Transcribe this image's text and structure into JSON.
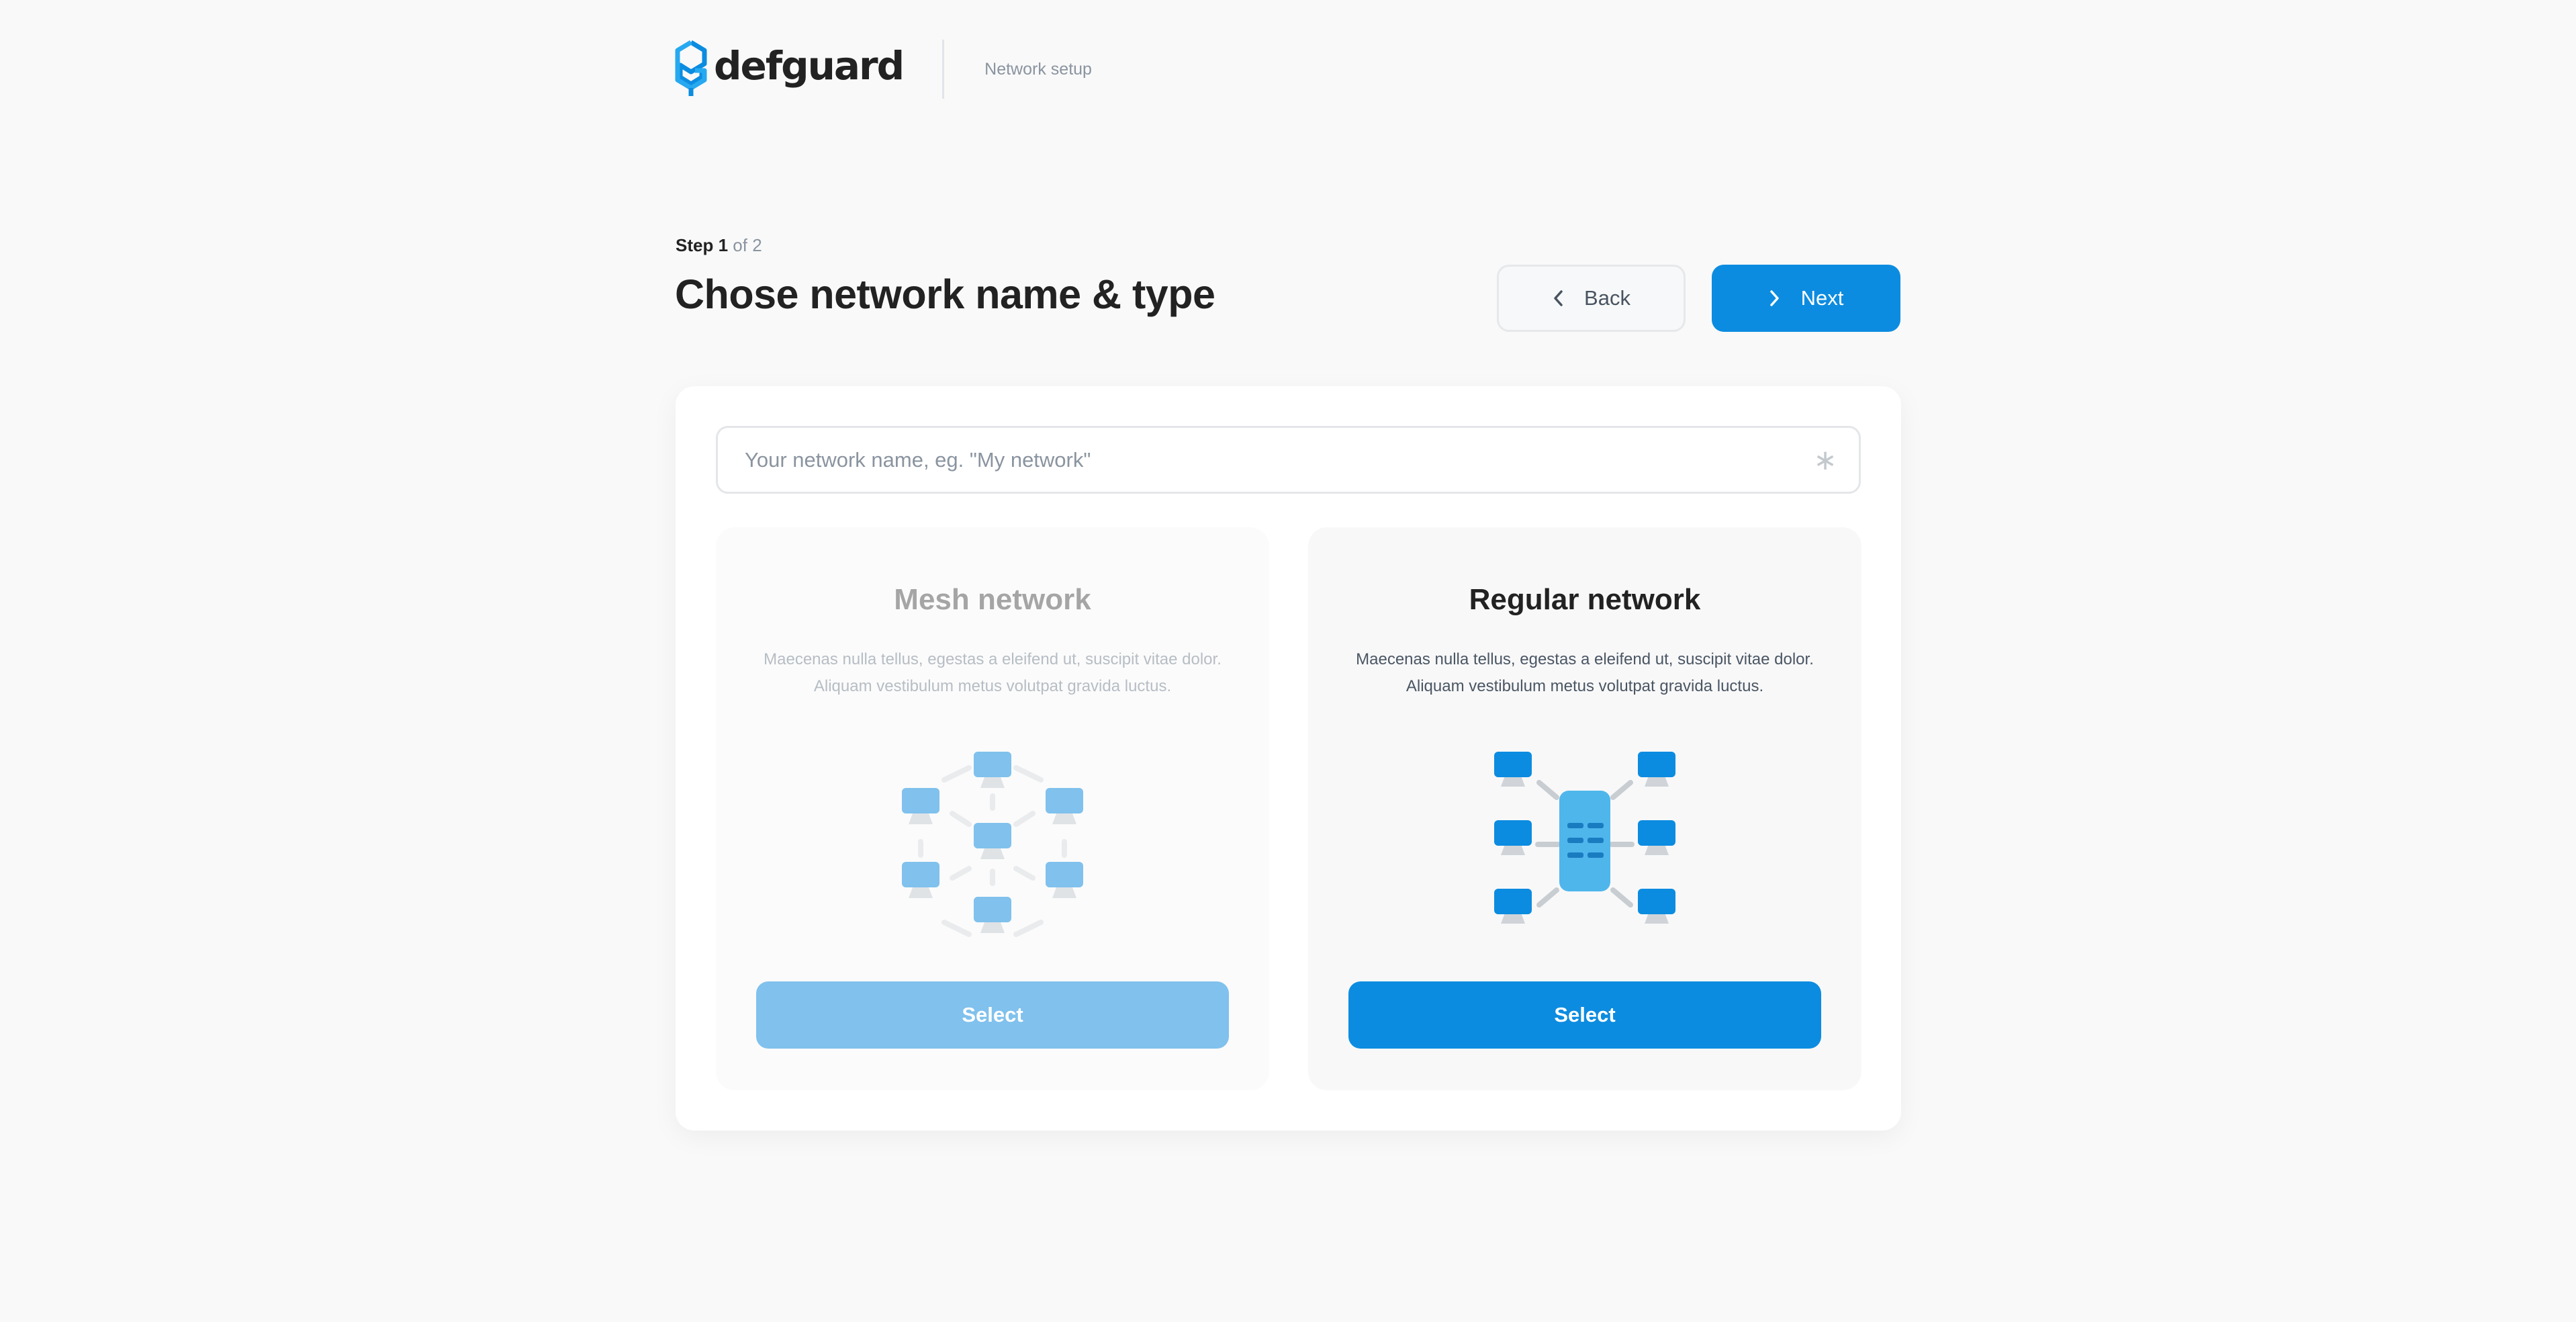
{
  "header": {
    "logo_text": "defguard",
    "section_label": "Network setup"
  },
  "wizard": {
    "step_label": "Step",
    "step_current": "1",
    "step_total_text": "of 2",
    "title": "Chose network name & type",
    "back_label": "Back",
    "next_label": "Next"
  },
  "form": {
    "network_name": {
      "placeholder": "Your network name, eg. \"My network\"",
      "value": "",
      "required_icon": "asterisk-icon"
    }
  },
  "network_types": [
    {
      "title": "Mesh network",
      "description_line1": "Maecenas nulla tellus, egestas a eleifend ut, suscipit vitae dolor.",
      "description_line2": "Aliquam vestibulum metus volutpat gravida luctus.",
      "select_label": "Select",
      "icon": "mesh-network-illustration",
      "state": "inactive"
    },
    {
      "title": "Regular network",
      "description_line1": "Maecenas nulla tellus, egestas a eleifend ut, suscipit vitae dolor.",
      "description_line2": "Aliquam vestibulum metus volutpat gravida luctus.",
      "select_label": "Select",
      "icon": "regular-network-illustration",
      "state": "active"
    }
  ],
  "colors": {
    "accent": "#0c8ce0",
    "page_background": "#f9f9f9",
    "text_primary": "#222222",
    "text_muted": "#8a94a0"
  }
}
